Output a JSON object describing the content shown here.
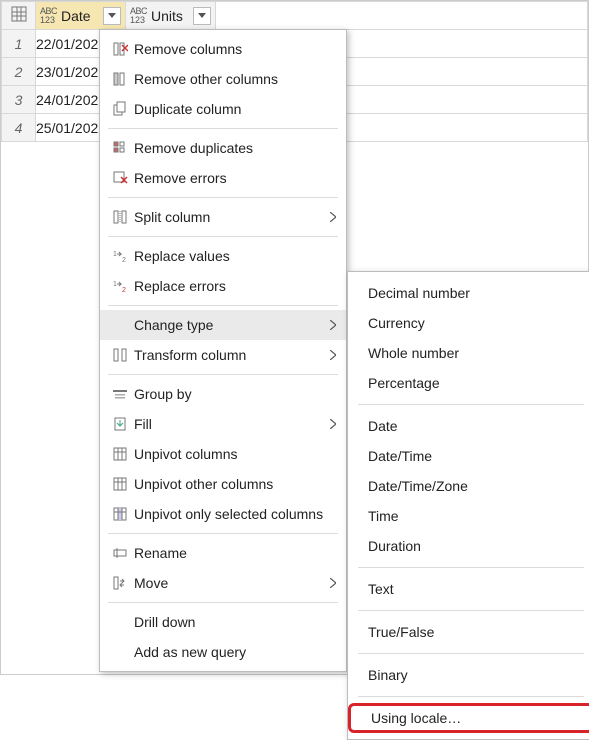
{
  "columns": [
    {
      "label": "Date",
      "type_icon": "abc-123-icon",
      "selected": true
    },
    {
      "label": "Units",
      "type_icon": "abc-123-icon",
      "selected": false
    }
  ],
  "rows": [
    {
      "num": "1",
      "date": "22/01/202"
    },
    {
      "num": "2",
      "date": "23/01/202"
    },
    {
      "num": "3",
      "date": "24/01/202"
    },
    {
      "num": "4",
      "date": "25/01/202"
    }
  ],
  "menu": {
    "remove_columns": "Remove columns",
    "remove_other_columns": "Remove other columns",
    "duplicate_column": "Duplicate column",
    "remove_duplicates": "Remove duplicates",
    "remove_errors": "Remove errors",
    "split_column": "Split column",
    "replace_values": "Replace values",
    "replace_errors": "Replace errors",
    "change_type": "Change type",
    "transform_column": "Transform column",
    "group_by": "Group by",
    "fill": "Fill",
    "unpivot_columns": "Unpivot columns",
    "unpivot_other_columns": "Unpivot other columns",
    "unpivot_selected": "Unpivot only selected columns",
    "rename": "Rename",
    "move": "Move",
    "drill_down": "Drill down",
    "add_as_new_query": "Add as new query"
  },
  "submenu": {
    "decimal": "Decimal number",
    "currency": "Currency",
    "whole": "Whole number",
    "percentage": "Percentage",
    "date": "Date",
    "datetime": "Date/Time",
    "datetimezone": "Date/Time/Zone",
    "time": "Time",
    "duration": "Duration",
    "text": "Text",
    "truefalse": "True/False",
    "binary": "Binary",
    "using_locale": "Using locale…"
  }
}
